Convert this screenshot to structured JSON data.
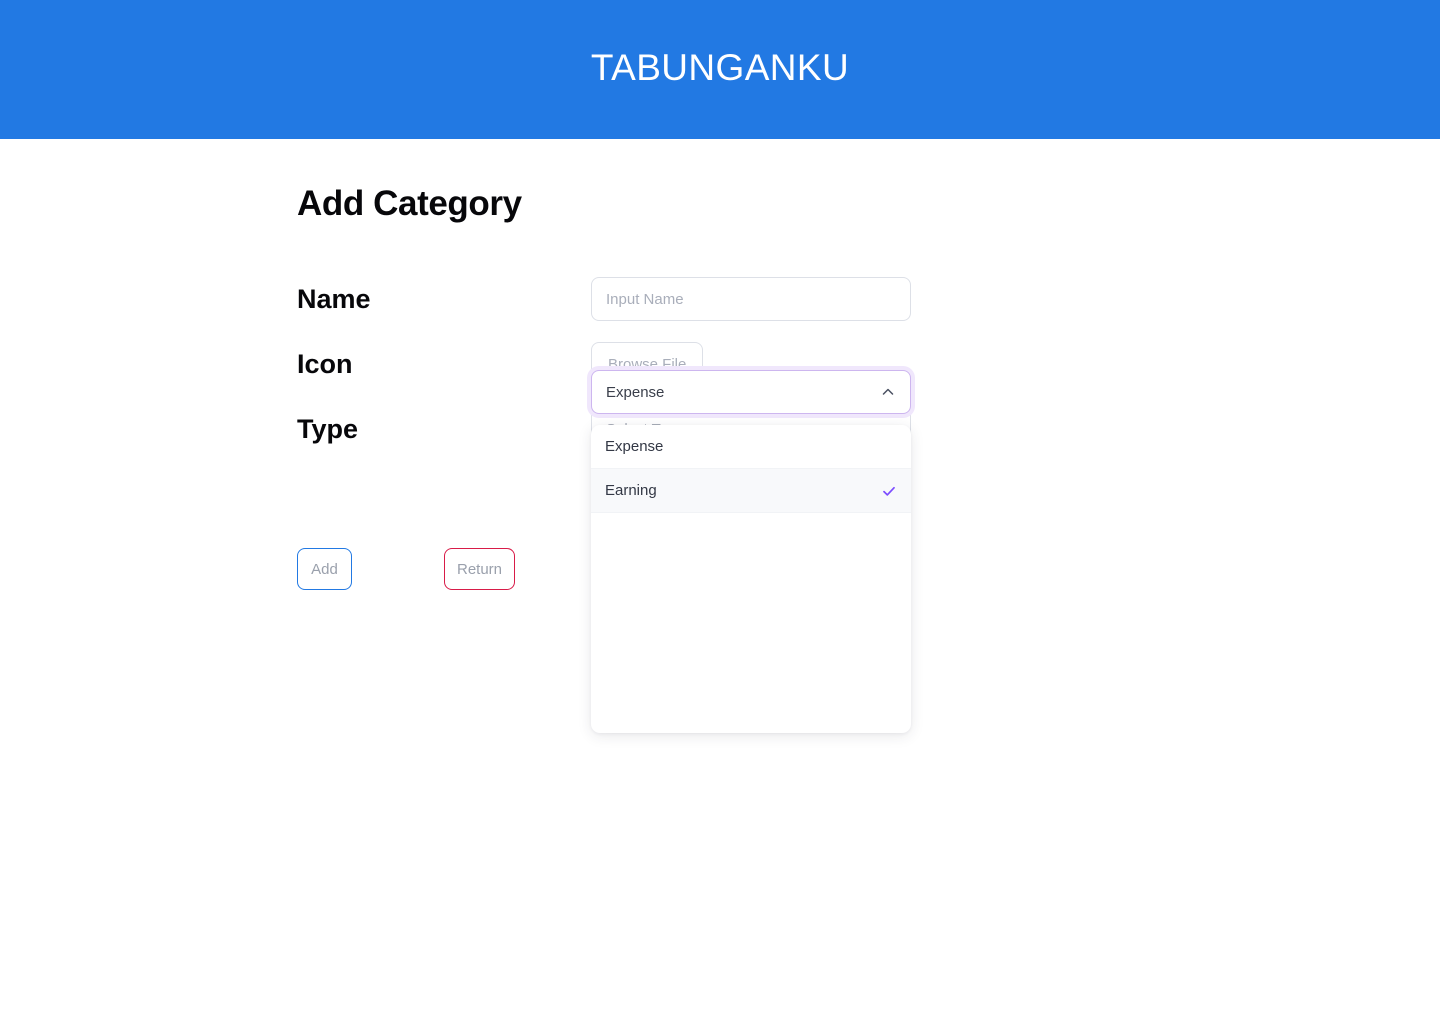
{
  "header": {
    "app_title": "TABUNGANKU",
    "background_color": "#2279E3",
    "title_color": "#FFFFFF"
  },
  "page": {
    "title": "Add Category"
  },
  "form": {
    "fields": [
      {
        "label": "Name",
        "control": "text-input",
        "value": "",
        "placeholder": "Input Name"
      },
      {
        "label": "Icon",
        "control": "file-button",
        "button_label": "Browse File"
      },
      {
        "label": "Type",
        "control": "select",
        "value": "",
        "placeholder": "Select Type",
        "chevron": "chevron-down-icon"
      }
    ],
    "open_select": {
      "value": "Expense",
      "chevron": "chevron-up-icon",
      "expanded": true,
      "focus_ring_color": "#CDB6EF",
      "options": [
        {
          "label": "Expense",
          "selected": false
        },
        {
          "label": "Earning",
          "selected": true
        }
      ],
      "check_color": "#7C4DFF"
    }
  },
  "actions": {
    "add_label": "Add",
    "add_border_color": "#2279E3",
    "return_label": "Return",
    "return_border_color": "#D81B48",
    "text_color": "#9AA0AC"
  }
}
